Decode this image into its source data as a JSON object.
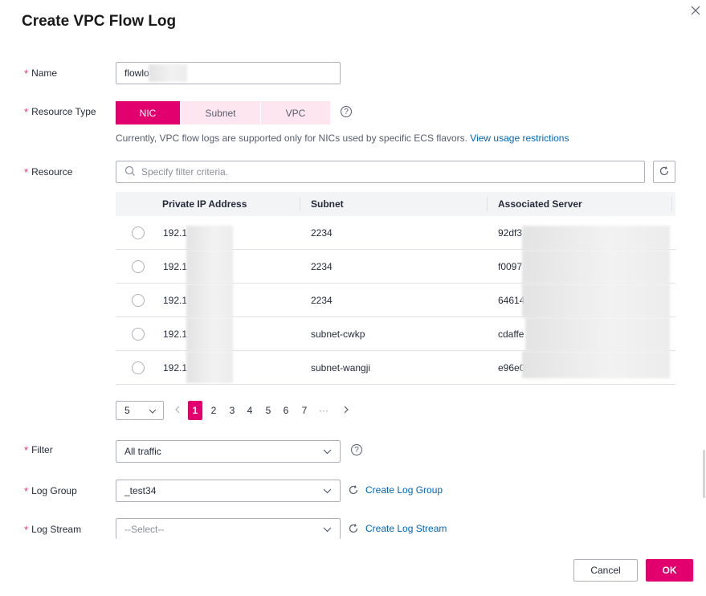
{
  "dialog": {
    "title": "Create VPC Flow Log"
  },
  "form": {
    "required_mark": "*",
    "name": {
      "label": "Name",
      "value": "flowlo"
    },
    "resource_type": {
      "label": "Resource Type",
      "options": [
        "NIC",
        "Subnet",
        "VPC"
      ],
      "selected": "NIC",
      "hint": "Currently, VPC flow logs are supported only for NICs used by specific ECS flavors.",
      "hint_link": "View usage restrictions"
    },
    "resource": {
      "label": "Resource",
      "search_placeholder": "Specify filter criteria."
    },
    "filter": {
      "label": "Filter",
      "value": "All traffic"
    },
    "log_group": {
      "label": "Log Group",
      "value": "_test34",
      "create_link": "Create Log Group"
    },
    "log_stream": {
      "label": "Log Stream",
      "placeholder": "--Select--",
      "create_link": "Create Log Stream"
    }
  },
  "table": {
    "columns": [
      "Private IP Address",
      "Subnet",
      "Associated Server"
    ],
    "rows": [
      {
        "ip": "192.1",
        "subnet": "2234",
        "server": "92df3"
      },
      {
        "ip": "192.1",
        "subnet": "2234",
        "server": "f0097"
      },
      {
        "ip": "192.1",
        "subnet": "2234",
        "server": "64614"
      },
      {
        "ip": "192.1",
        "subnet": "subnet-cwkp",
        "server": "cdaffe"
      },
      {
        "ip": "192.1",
        "subnet": "subnet-wangji",
        "server": "e96e0"
      }
    ]
  },
  "pagination": {
    "page_size": "5",
    "pages": [
      "1",
      "2",
      "3",
      "4",
      "5",
      "6",
      "7"
    ],
    "ellipsis": "···",
    "current_page": 1
  },
  "footer": {
    "cancel_label": "Cancel",
    "ok_label": "OK"
  },
  "colors": {
    "accent": "#e1006e",
    "accent_light": "#fde6f0",
    "link": "#0066b3",
    "border": "#adb0b8"
  },
  "icons": [
    "close-icon",
    "help-icon",
    "search-icon",
    "refresh-icon",
    "chevron-down-icon",
    "chevron-left-icon",
    "chevron-right-icon"
  ]
}
